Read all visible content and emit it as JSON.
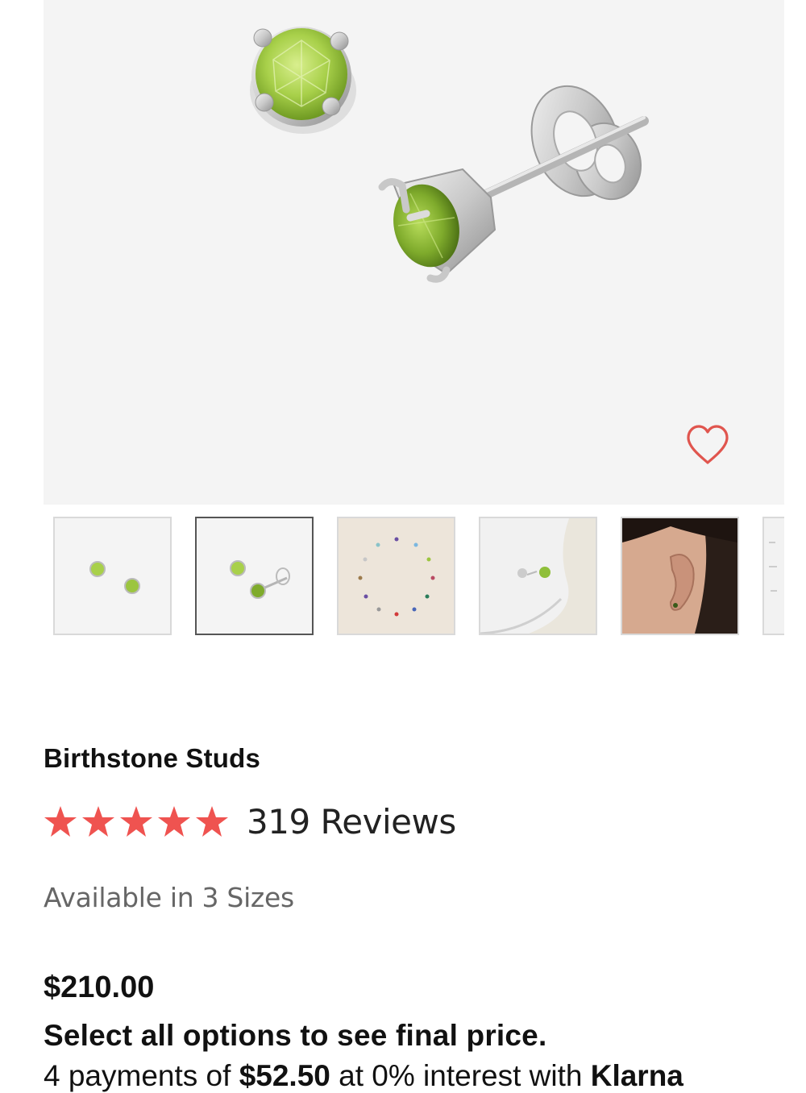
{
  "product": {
    "title": "Birthstone Studs",
    "rating": 5,
    "rating_max": 5,
    "reviews_label": "319 Reviews",
    "availability": "Available in 3 Sizes",
    "price": "$210.00",
    "price_note": "Select all options to see final price.",
    "financing": {
      "prefix": "4 payments of ",
      "amount": "$52.50",
      "middle": " at 0% interest with ",
      "provider": "Klarna"
    }
  },
  "gallery": {
    "selected_index": 1,
    "thumbnails": [
      {
        "name": "thumbnail-studs-pair"
      },
      {
        "name": "thumbnail-studs-side"
      },
      {
        "name": "thumbnail-birthstone-circle"
      },
      {
        "name": "thumbnail-studs-on-dish"
      },
      {
        "name": "thumbnail-model-ear"
      },
      {
        "name": "thumbnail-partial"
      }
    ]
  },
  "colors": {
    "star": "#ef5350",
    "heart": "#e0554e",
    "peridot": "#a8d04a",
    "hero_bg": "#f4f4f4"
  },
  "icons": {
    "wishlist": "heart-outline-icon",
    "star": "star-filled-icon"
  }
}
